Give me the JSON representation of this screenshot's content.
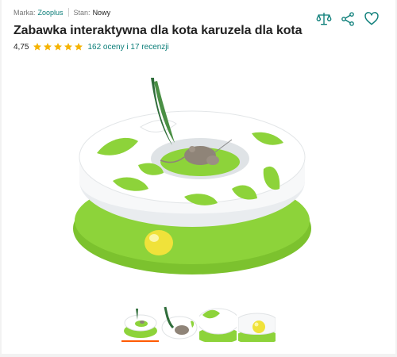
{
  "meta": {
    "brand_label": "Marka:",
    "brand_value": "Zooplus",
    "condition_label": "Stan:",
    "condition_value": "Nowy"
  },
  "product": {
    "title": "Zabawka interaktywna dla kota karuzela dla kota"
  },
  "rating": {
    "score": "4,75",
    "stars": 4.75,
    "reviews_text": "162 oceny i 17 recenzji"
  },
  "actions": [
    {
      "icon": "compare-scales-icon"
    },
    {
      "icon": "share-icon"
    },
    {
      "icon": "heart-icon"
    }
  ],
  "gallery": {
    "thumbnails_count": 4,
    "active_index": 0
  },
  "colors": {
    "accent_link": "#0a7d78",
    "star": "#f5b301",
    "active_thumb": "#ff5a00",
    "toy_green": "#8dd33a"
  }
}
